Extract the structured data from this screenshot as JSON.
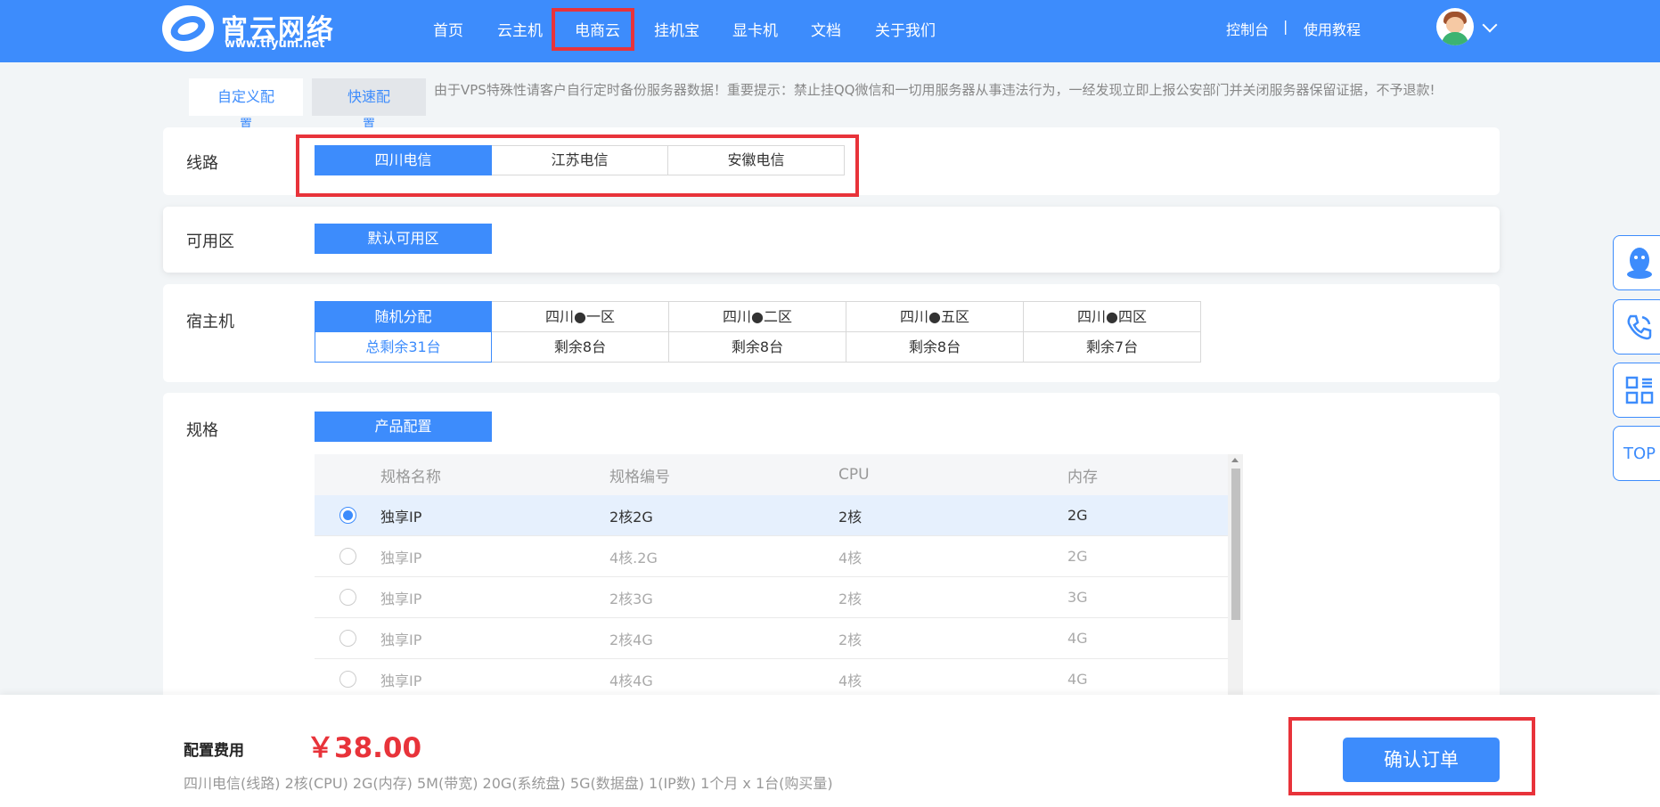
{
  "header": {
    "logo_name": "宵云网络",
    "logo_url": "www.tfyum.net",
    "nav": [
      "首页",
      "云主机",
      "电商云",
      "挂机宝",
      "显卡机",
      "文档",
      "关于我们"
    ],
    "active_nav": "电商云",
    "console": "控制台",
    "separator": "|",
    "tutorial": "使用教程"
  },
  "tabs": {
    "custom": "自定义配",
    "custom_wrap": "置",
    "quick": "快速配",
    "quick_wrap": "置"
  },
  "notice": "由于VPS特殊性请客户自行定时备份服务器数据！重要提示：禁止挂QQ微信和一切用服务器从事违法行为，一经发现立即上报公安部门并关闭服务器保留证据，不予退款!",
  "line": {
    "label": "线路",
    "options": [
      "四川电信",
      "江苏电信",
      "安徽电信"
    ],
    "selected": "四川电信"
  },
  "zone": {
    "label": "可用区",
    "options": [
      "默认可用区"
    ],
    "selected": "默认可用区"
  },
  "host": {
    "label": "宿主机",
    "columns": [
      {
        "name": "随机分配",
        "remain": "总剩余31台"
      },
      {
        "name": "四川●一区",
        "remain": "剩余8台"
      },
      {
        "name": "四川●二区",
        "remain": "剩余8台"
      },
      {
        "name": "四川●五区",
        "remain": "剩余8台"
      },
      {
        "name": "四川●四区",
        "remain": "剩余7台"
      }
    ],
    "selected": "随机分配"
  },
  "spec": {
    "label": "规格",
    "button": "产品配置",
    "headers": {
      "name": "规格名称",
      "code": "规格编号",
      "cpu": "CPU",
      "mem": "内存"
    },
    "rows": [
      {
        "name": "独享IP",
        "code": "2核2G",
        "cpu": "2核",
        "mem": "2G",
        "selected": true
      },
      {
        "name": "独享IP",
        "code": "4核.2G",
        "cpu": "4核",
        "mem": "2G",
        "selected": false
      },
      {
        "name": "独享IP",
        "code": "2核3G",
        "cpu": "2核",
        "mem": "3G",
        "selected": false
      },
      {
        "name": "独享IP",
        "code": "2核4G",
        "cpu": "2核",
        "mem": "4G",
        "selected": false
      },
      {
        "name": "独享IP",
        "code": "4核4G",
        "cpu": "4核",
        "mem": "4G",
        "selected": false
      }
    ]
  },
  "side": {
    "top": "TOP",
    "icons": [
      "qq-icon",
      "phone-icon",
      "qrcode-icon"
    ]
  },
  "footer": {
    "fee_label": "配置费用",
    "price": "￥38.00",
    "summary": "四川电信(线路) 2核(CPU) 2G(内存) 5M(带宽) 20G(系统盘) 5G(数据盘) 1(IP数) 1个月 x 1台(购买量)",
    "confirm": "确认订单"
  },
  "colors": {
    "primary": "#3d8cfc",
    "highlight": "#e8333a",
    "price": "#e8333a"
  }
}
